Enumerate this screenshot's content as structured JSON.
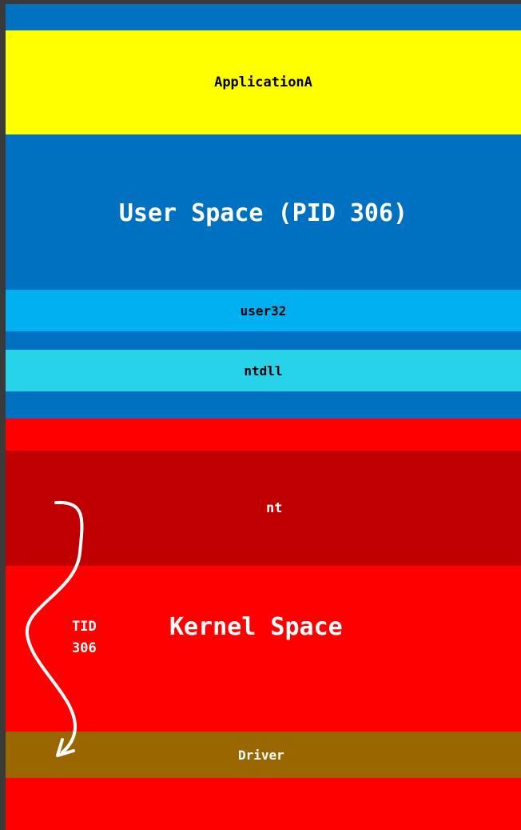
{
  "colors": {
    "background": "#3a3a3a",
    "user_space": "#0070C0",
    "application": "#FFFF00",
    "user32": "#00B0F0",
    "ntdll": "#27D3E8",
    "kernel_space": "#FF0000",
    "nt": "#C00000",
    "driver": "#996600",
    "arrow": "#FFFFFF"
  },
  "user_space": {
    "application_label": "ApplicationA",
    "title": "User Space (PID 306)",
    "user32_label": "user32",
    "ntdll_label": "ntdll"
  },
  "kernel_space": {
    "nt_label": "nt",
    "title": "Kernel Space",
    "driver_label": "Driver"
  },
  "thread": {
    "label_line1": "TID",
    "label_line2": "306",
    "arrow_icon": "curved-down-arrow-icon"
  }
}
